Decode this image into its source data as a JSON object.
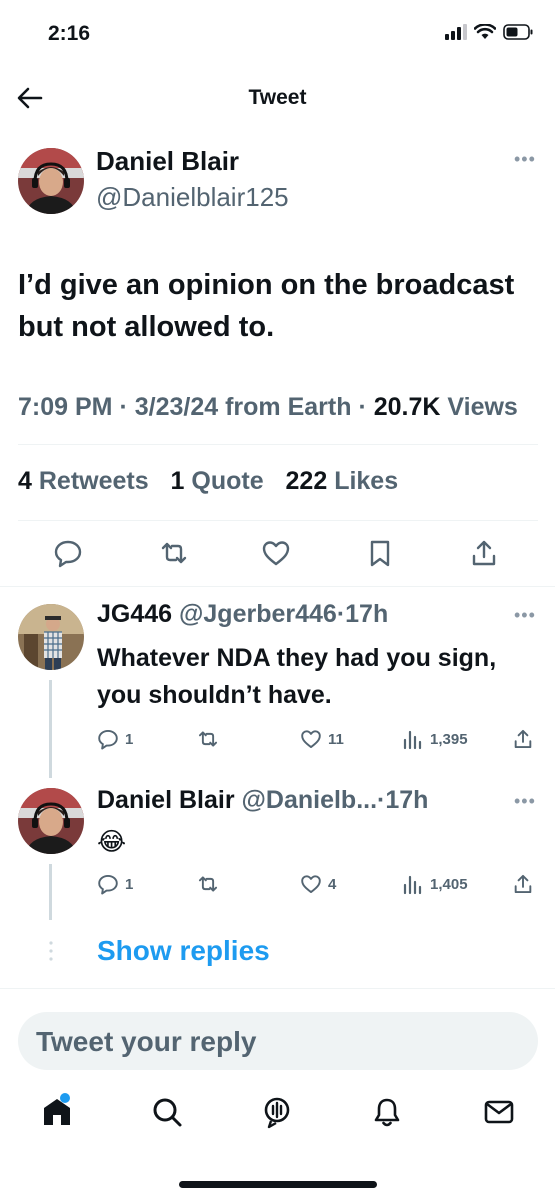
{
  "status": {
    "time": "2:16"
  },
  "nav": {
    "title": "Tweet"
  },
  "tweet": {
    "author_name": "Daniel Blair",
    "author_handle": "@Danielblair125",
    "text": "I’d give an opinion on the broadcast but not allowed to.",
    "time": "7:09 PM",
    "date": "3/23/24",
    "source": "from Earth",
    "views_count": "20.7K",
    "views_label": "Views",
    "retweets_count": "4",
    "retweets_label": "Retweets",
    "quotes_count": "1",
    "quotes_label": "Quote",
    "likes_count": "222",
    "likes_label": "Likes"
  },
  "replies": [
    {
      "name": "JG446",
      "handle": "@Jgerber446",
      "time": "17h",
      "text": "Whatever NDA they had you sign, you shouldn’t have.",
      "reply_count": "1",
      "like_count": "11",
      "view_count": "1,395"
    },
    {
      "name": "Daniel Blair",
      "handle": "@Danielb...",
      "time": "17h",
      "text": "😂",
      "reply_count": "1",
      "like_count": "4",
      "view_count": "1,405"
    }
  ],
  "show_replies_label": "Show replies",
  "reply_box": {
    "placeholder": "Tweet your reply"
  },
  "colors": {
    "accent": "#1d9bf0",
    "text": "#0f1419",
    "muted": "#536471",
    "divider": "#eff3f4"
  },
  "icons": {
    "status": [
      "signal-icon",
      "wifi-icon",
      "battery-icon"
    ],
    "tweet_actions": [
      "reply-icon",
      "retweet-icon",
      "like-icon",
      "bookmark-icon",
      "share-icon"
    ],
    "tab_bar": [
      "home-icon",
      "search-icon",
      "spaces-icon",
      "notifications-icon",
      "messages-icon"
    ]
  }
}
